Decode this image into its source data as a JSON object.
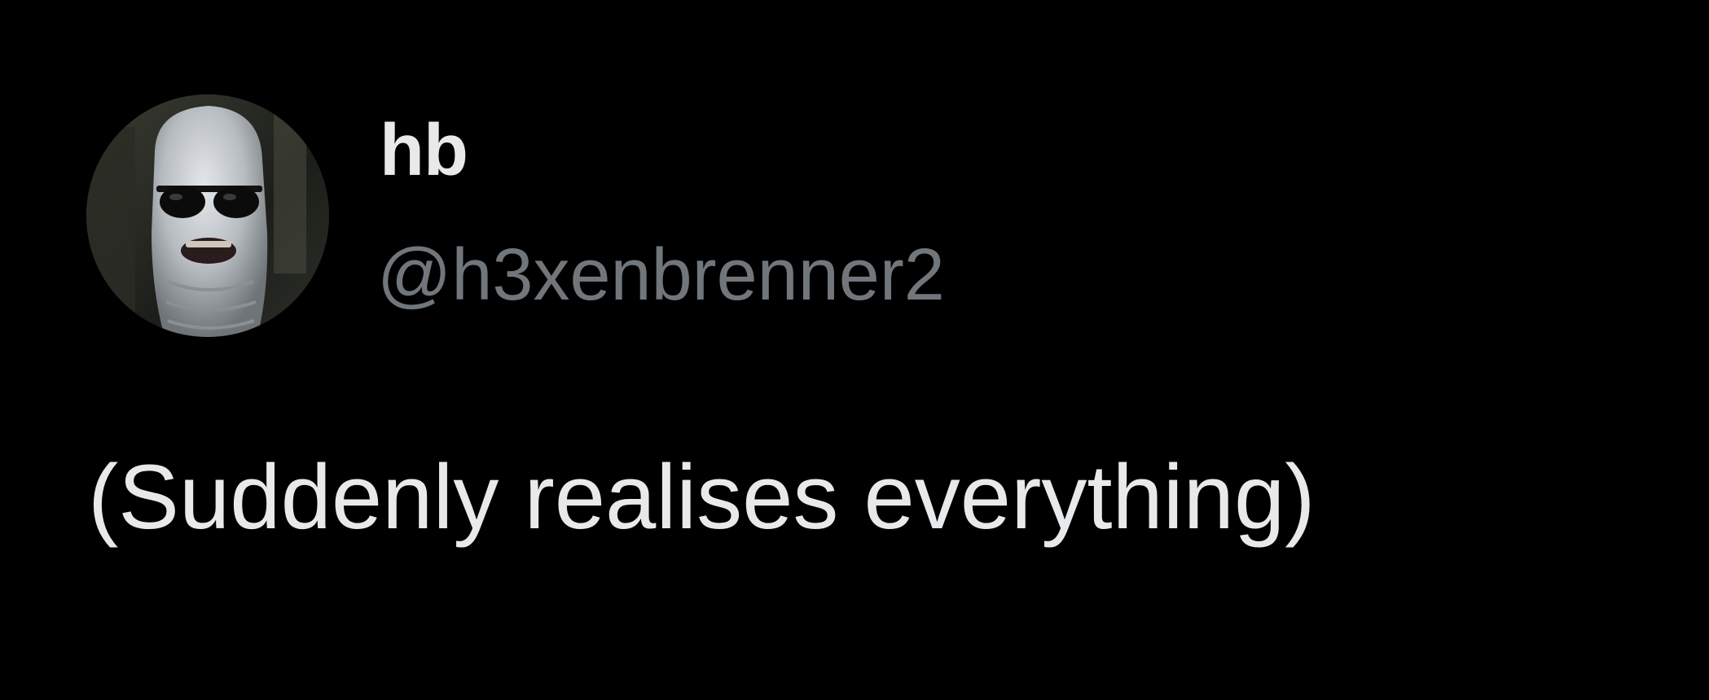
{
  "tweet": {
    "author": {
      "display_name": "hb",
      "handle": "@h3xenbrenner2",
      "avatar_icon": "profile-avatar"
    },
    "text": "(Suddenly realises everything)"
  },
  "colors": {
    "background": "#000000",
    "display_name": "#E7E9EA",
    "handle": "#71767B",
    "text": "#E7E9EA"
  }
}
